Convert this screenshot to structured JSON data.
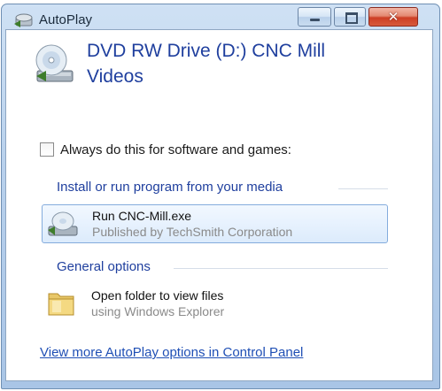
{
  "window": {
    "title": "AutoPlay"
  },
  "header": {
    "title": "DVD RW Drive (D:) CNC Mill Videos"
  },
  "checkbox": {
    "label": "Always do this for software and games:",
    "checked": false
  },
  "sections": {
    "install": {
      "title": "Install or run program from your media",
      "option": {
        "title": "Run CNC-Mill.exe",
        "subtitle": "Published by TechSmith Corporation"
      }
    },
    "general": {
      "title": "General options",
      "option": {
        "title": "Open folder to view files",
        "subtitle": "using Windows Explorer"
      }
    }
  },
  "footer": {
    "link": "View more AutoPlay options in Control Panel"
  },
  "icons": {
    "app": "autoplay-icon",
    "drive": "dvd-drive-icon",
    "program": "dvd-drive-icon",
    "folder": "folder-icon"
  }
}
